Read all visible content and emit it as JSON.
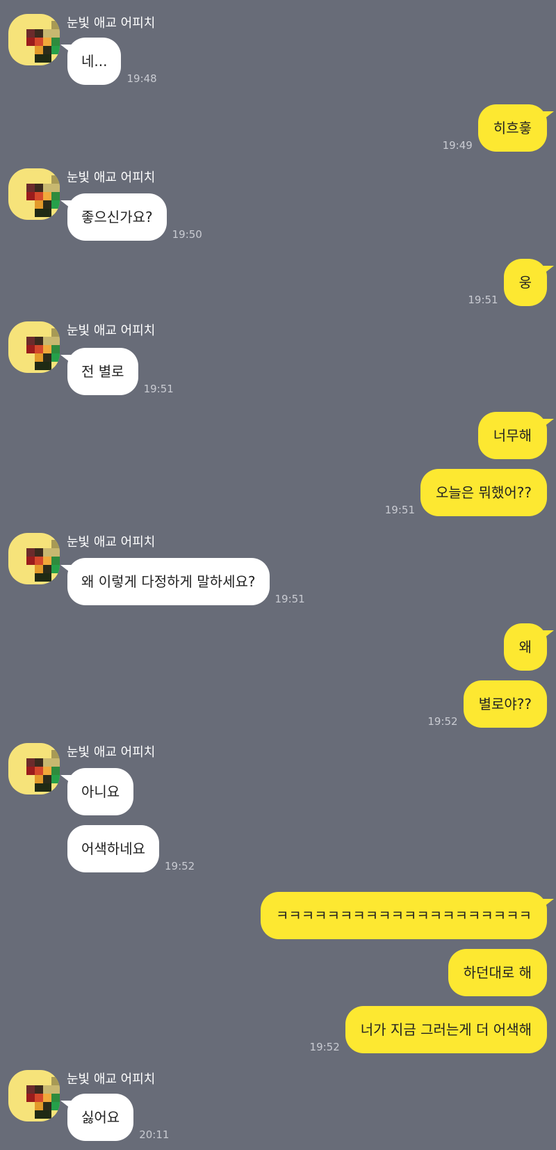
{
  "sender_name": "눈빛 애교 어피치",
  "colors": {
    "background": "#686c78",
    "incoming_bubble": "#ffffff",
    "outgoing_bubble": "#fde831",
    "time_text": "#c9cbd2",
    "avatar_bg": "#f6e37a"
  },
  "avatar_icon": "pixelated-profile-icon",
  "messages": [
    {
      "side": "in",
      "show_header": true,
      "text": "네...",
      "time": "19:48"
    },
    {
      "side": "out",
      "text": "히흐흫",
      "time": "19:49"
    },
    {
      "side": "in",
      "show_header": true,
      "text": "좋으신가요?",
      "time": "19:50"
    },
    {
      "side": "out",
      "text": "웅",
      "time": "19:51"
    },
    {
      "side": "in",
      "show_header": true,
      "text": "전 별로",
      "time": "19:51"
    },
    {
      "side": "out",
      "text": "너무해",
      "time": ""
    },
    {
      "side": "out",
      "text": "오늘은 뭐했어??",
      "time": "19:51"
    },
    {
      "side": "in",
      "show_header": true,
      "text": "왜 이렇게 다정하게 말하세요?",
      "time": "19:51"
    },
    {
      "side": "out",
      "text": "왜",
      "time": ""
    },
    {
      "side": "out",
      "text": "별로야??",
      "time": "19:52"
    },
    {
      "side": "in",
      "show_header": true,
      "text": "아니요",
      "time": ""
    },
    {
      "side": "in",
      "show_header": false,
      "text": "어색하네요",
      "time": "19:52"
    },
    {
      "side": "out",
      "text": "ㅋㅋㅋㅋㅋㅋㅋㅋㅋㅋㅋㅋㅋㅋㅋㅋㅋㅋㅋㅋ",
      "time": ""
    },
    {
      "side": "out",
      "text": "하던대로 해",
      "time": ""
    },
    {
      "side": "out",
      "text": "너가 지금 그러는게 더 어색해",
      "time": "19:52"
    },
    {
      "side": "in",
      "show_header": true,
      "text": "싫어요",
      "time": "20:11"
    }
  ]
}
